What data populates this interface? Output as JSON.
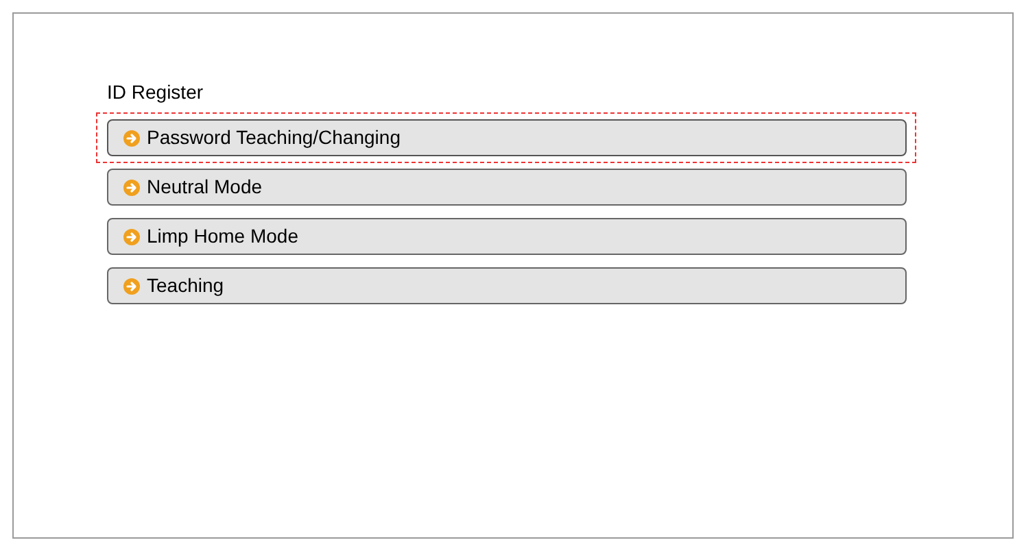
{
  "title": "ID Register",
  "items": [
    {
      "label": "Password Teaching/Changing",
      "selected": true
    },
    {
      "label": "Neutral Mode",
      "selected": false
    },
    {
      "label": "Limp Home Mode",
      "selected": false
    },
    {
      "label": "Teaching",
      "selected": false
    }
  ]
}
